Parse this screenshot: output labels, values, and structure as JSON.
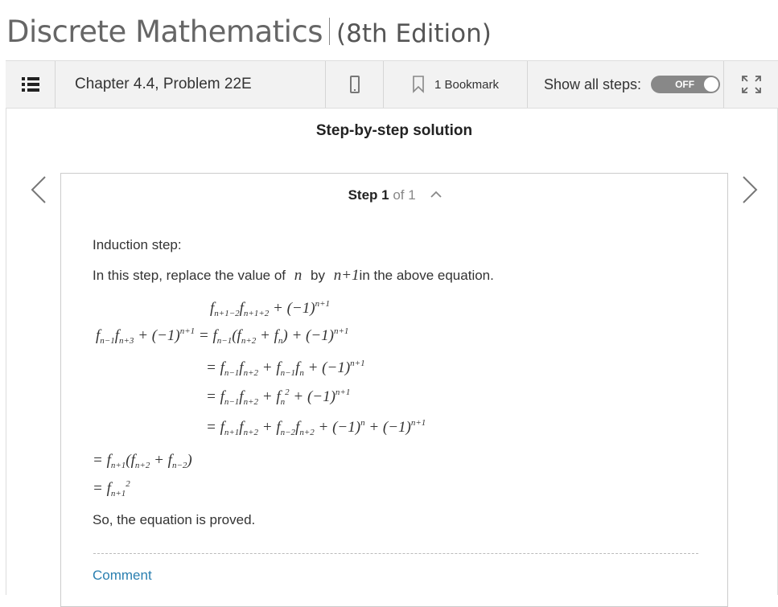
{
  "book": {
    "title": "Discrete Mathematics",
    "edition": "(8th Edition)"
  },
  "toolbar": {
    "chapter": "Chapter 4.4, Problem 22E",
    "bookmark_label": "1 Bookmark",
    "show_steps_label": "Show all steps:",
    "toggle_label": "OFF"
  },
  "solution": {
    "title": "Step-by-step solution",
    "step_word": "Step",
    "step_number": "1",
    "step_of": "of 1",
    "heading": "Induction step:",
    "intro_pre": "In this step, replace the value of",
    "intro_var": "n",
    "intro_mid": "by",
    "intro_expr": "n+1",
    "intro_post": "in the above equation.",
    "equations": [
      "f_{n+1−2}f_{n+1+2} + (−1)^{n+1}",
      "f_{n−1}f_{n+3} + (−1)^{n+1} = f_{n−1}(f_{n+2} + f_n) + (−1)^{n+1}",
      "= f_{n−1}f_{n+2} + f_{n−1}f_n + (−1)^{n+1}",
      "= f_{n−1}f_{n+2} + f_n^2 + (−1)^{n+1}",
      "= f_{n+1}f_{n+2} + f_{n−2}f_{n+2} + (−1)^n + (−1)^{n+1}",
      "= f_{n+1}(f_{n+2} + f_{n−2})",
      "= f_{n+1}^2"
    ],
    "conclusion": "So, the equation is proved.",
    "comment_label": "Comment"
  }
}
